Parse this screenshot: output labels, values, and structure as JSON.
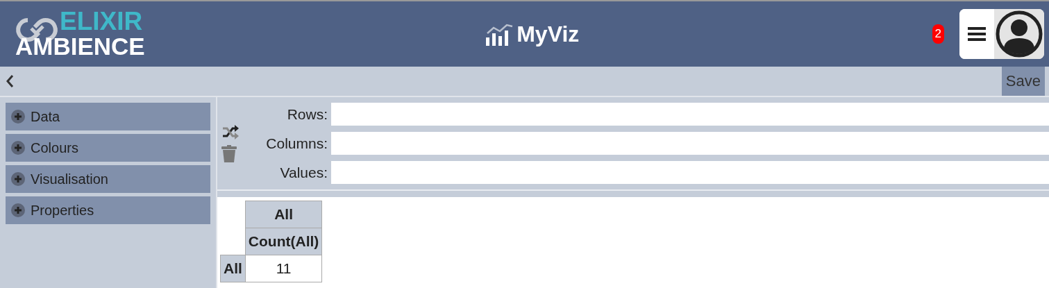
{
  "header": {
    "logo": {
      "top": "ELIXIR",
      "bottom": "AMBIENCE"
    },
    "title": "MyViz",
    "notification_count": "2"
  },
  "toolbar": {
    "save": "Save"
  },
  "sidebar": {
    "items": [
      {
        "label": "Data",
        "expanded": false
      },
      {
        "label": "Colours",
        "expanded": false
      },
      {
        "label": "Visualisation",
        "expanded": false
      },
      {
        "label": "Properties",
        "expanded": false
      }
    ]
  },
  "pivot_fields": [
    {
      "label": "Rows:"
    },
    {
      "label": "Columns:"
    },
    {
      "label": "Values:"
    }
  ],
  "pivot_table": {
    "column_header": "All",
    "measure_header": "Count(All)",
    "row_header": "All",
    "value": "11"
  }
}
